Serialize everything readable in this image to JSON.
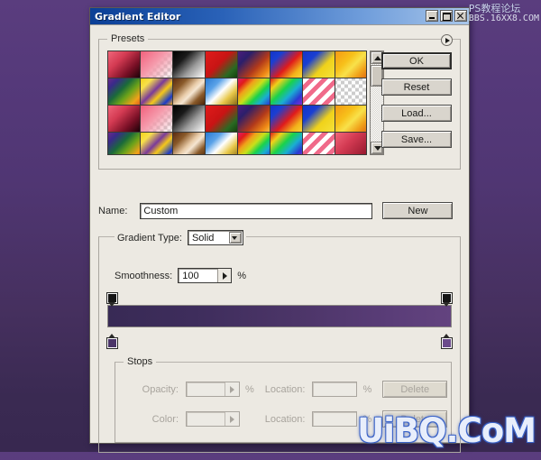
{
  "window": {
    "title": "Gradient Editor",
    "controls": [
      {
        "name": "minimize",
        "glyph": "_"
      },
      {
        "name": "maximize",
        "glyph": "□"
      },
      {
        "name": "close",
        "glyph": "×"
      }
    ]
  },
  "watermarks": {
    "top_line1": "PS教程论坛",
    "top_line2": "BBS.16XX8.COM",
    "bottom": "UiBQ.CoM"
  },
  "presets": {
    "legend": "Presets",
    "arrow_icon": "play-triangle-icon",
    "thumbnails": [
      "linear-gradient(135deg,#f0667a 0%,#d33a52 35%,#7a1026 70%,#1c0208 100%)",
      "linear-gradient(135deg,#f2607c 0%,#f59aab 45%,rgba(255,255,255,0) 100%), repeating-conic-gradient(#ffffff 0% 25%, #cccccc 0% 50%) 50% / 8px 8px",
      "linear-gradient(135deg,#000000 0%,#1a1a1a 30%,#9a9a9a 62%,#ffffff 100%)",
      "linear-gradient(135deg,#e01b1b 0%,#c81414 45%,#2a6a22 78%,#14410f 100%)",
      "linear-gradient(135deg,#4b1d7a 0%,#2c1f6b 25%,#b33a1a 60%,#f08a16 85%,#f5c04a 100%)",
      "linear-gradient(135deg,#1433c8 0%,#1a3fd2 22%,#e01b1b 55%,#f2b21a 80%,#f7d534 100%)",
      "linear-gradient(135deg,#1433c8 0%,#1a3fd2 28%,#f0d21a 62%,#f5e23a 100%)",
      "linear-gradient(135deg,#f59a14 0%,#f7c01a 35%,#f8e14a 55%,#f0a21a 78%,#e06a12 100%)",
      "linear-gradient(135deg,#6a2a8a 0%,#3a2a8a 18%,#1a6a3a 42%,#6aa21a 62%,#f0a21a 85%,#e0601a 100%)",
      "linear-gradient(135deg,#f5d21a 0%,#f7e04a 20%,#7a3a9a 45%,#f5c81a 62%,#1a3ac8 85%,#f2a41a 100%)",
      "linear-gradient(135deg,#5a2a10 0%,#8a5a2a 25%,#e8cba8 48%,#f5e6d2 58%,#8a5a2a 78%,#4a2408 100%)",
      "linear-gradient(135deg,#2a7ad2 0%,#5aa2e8 28%,#ffffff 50%,#e8c84a 72%,#8a6a14 100%)",
      "linear-gradient(135deg,#e01b6a 0%,#e01b1b 16%,#f0a21a 32%,#c8e01a 48%,#1ad24a 64%,#1aaed2 80%,#2a3ad2 100%)",
      "linear-gradient(135deg,#e01b1b 0%,#f0d21a 20%,#1ad24a 42%,#1aaed2 62%,#2a3ad2 82%,#8a2ad2 100%)",
      "repeating-linear-gradient(135deg,#ffffff 0 5px,#f06a8a 5px 10px)",
      "repeating-conic-gradient(#ffffff 0% 25%, #cccccc 0% 50%) 50% / 8px 8px",
      "linear-gradient(135deg,#f0667a 0%,#d33a52 35%,#7a1026 70%,#1c0208 100%)",
      "linear-gradient(135deg,#f2607c 0%,#f59aab 45%,rgba(255,255,255,0) 100%), repeating-conic-gradient(#ffffff 0% 25%, #cccccc 0% 50%) 50% / 8px 8px",
      "linear-gradient(135deg,#000000 0%,#1a1a1a 30%,#9a9a9a 62%,#ffffff 100%)",
      "linear-gradient(135deg,#e01b1b 0%,#c81414 45%,#2a6a22 78%,#14410f 100%)",
      "linear-gradient(135deg,#4b1d7a 0%,#2c1f6b 25%,#b33a1a 60%,#f08a16 85%,#f5c04a 100%)",
      "linear-gradient(135deg,#1433c8 0%,#1a3fd2 22%,#e01b1b 55%,#f2b21a 80%,#f7d534 100%)",
      "linear-gradient(135deg,#1433c8 0%,#1a3fd2 28%,#f0d21a 62%,#f5e23a 100%)",
      "linear-gradient(135deg,#f59a14 0%,#f7c01a 35%,#f8e14a 55%,#f0a21a 78%,#e06a12 100%)",
      "linear-gradient(135deg,#6a2a8a 0%,#3a2a8a 18%,#1a6a3a 42%,#6aa21a 62%,#f0a21a 85%,#e0601a 100%)",
      "linear-gradient(135deg,#f5d21a 0%,#f7e04a 20%,#7a3a9a 45%,#f5c81a 62%,#1a3ac8 85%,#f2a41a 100%)",
      "linear-gradient(135deg,#5a2a10 0%,#8a5a2a 25%,#e8cba8 48%,#f5e6d2 58%,#8a5a2a 78%,#4a2408 100%)",
      "linear-gradient(135deg,#2a7ad2 0%,#5aa2e8 28%,#ffffff 50%,#e8c84a 72%,#8a6a14 100%)",
      "linear-gradient(135deg,#e01b6a 0%,#e01b1b 16%,#f0a21a 32%,#c8e01a 48%,#1ad24a 64%,#1aaed2 80%,#2a3ad2 100%)",
      "linear-gradient(135deg,#e01b1b 0%,#f0d21a 20%,#1ad24a 42%,#1aaed2 62%,#2a3ad2 82%,#8a2ad2 100%)",
      "repeating-linear-gradient(135deg,#ffffff 0 5px,#f06a8a 5px 10px)",
      "linear-gradient(135deg,#f0667a 0%,#d33a52 40%,#8a1228 100%)"
    ]
  },
  "buttons": {
    "ok": "OK",
    "reset": "Reset",
    "load": "Load...",
    "save": "Save...",
    "new": "New"
  },
  "name_row": {
    "label": "Name:",
    "value": "Custom"
  },
  "gradient_settings": {
    "type_label": "Gradient Type:",
    "type_value": "Solid",
    "smoothness_label": "Smoothness:",
    "smoothness_value": "100",
    "percent": "%"
  },
  "gradient_bar": {
    "css": "linear-gradient(90deg,#382a55 0%,#3e2d5c 25%,#4c3568 55%,#5a3d78 82%,#63437f 100%)",
    "opacity_stops": [
      {
        "position": 0,
        "color": "#151515"
      },
      {
        "position": 100,
        "color": "#151515"
      }
    ],
    "color_stops": [
      {
        "position": 0,
        "color": "#4a3468"
      },
      {
        "position": 100,
        "color": "#6b4a8c"
      }
    ]
  },
  "stops": {
    "legend": "Stops",
    "opacity_label": "Opacity:",
    "opacity_value": "",
    "opacity_location_label": "Location:",
    "opacity_location_value": "",
    "opacity_delete": "Delete",
    "color_label": "Color:",
    "color_value": "",
    "color_location_label": "Location:",
    "color_location_value": "",
    "color_delete": "Delete",
    "percent": "%",
    "disabled": true
  }
}
